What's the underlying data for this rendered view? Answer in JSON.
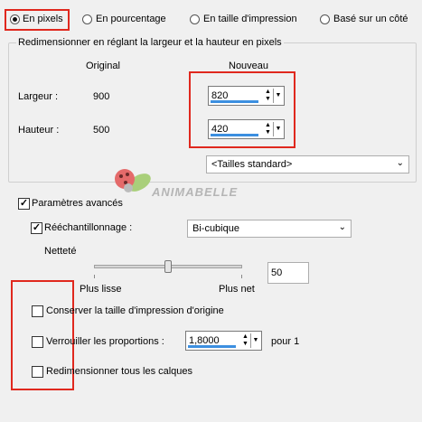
{
  "modes": {
    "pixels": "En pixels",
    "percent": "En pourcentage",
    "print": "En taille d'impression",
    "side": "Basé sur un côté",
    "selected": "pixels"
  },
  "resize_group": {
    "title": "Redimensionner en réglant la largeur et la hauteur en pixels",
    "col_original": "Original",
    "col_new": "Nouveau",
    "width_label": "Largeur :",
    "width_original": "900",
    "width_new": "820",
    "height_label": "Hauteur :",
    "height_original": "500",
    "height_new": "420",
    "preset_select": "<Tailles standard>"
  },
  "watermark": "ANIMABELLE",
  "advanced": {
    "label": "Paramètres avancés",
    "checked": true
  },
  "resample": {
    "label": "Rééchantillonnage :",
    "checked": true,
    "method": "Bi-cubique"
  },
  "sharpness": {
    "label": "Netteté",
    "left_label": "Plus lisse",
    "right_label": "Plus net",
    "value": "50",
    "level": 0.5
  },
  "keep_print_size": {
    "label": "Conserver la taille d'impression d'origine",
    "checked": false
  },
  "lock_ratio": {
    "label": "Verrouiller les proportions :",
    "checked": false,
    "value": "1,8000",
    "suffix": "pour 1"
  },
  "resize_all_layers": {
    "label": "Redimensionner tous les calques",
    "checked": false
  }
}
